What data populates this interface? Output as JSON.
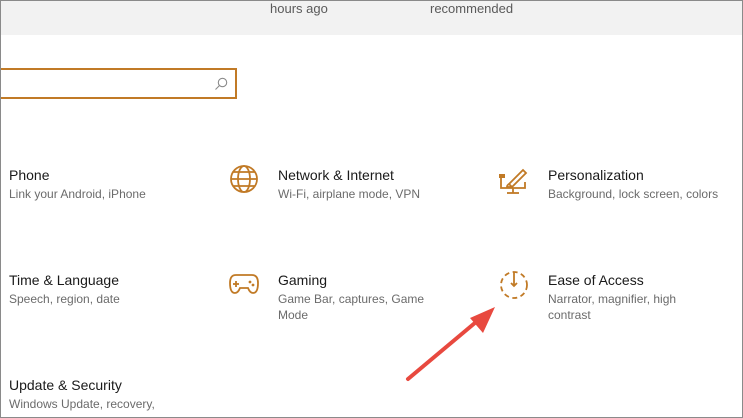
{
  "top": {
    "text_left": "hours ago",
    "text_right": "recommended"
  },
  "search": {
    "value": "",
    "placeholder": ""
  },
  "tiles": [
    {
      "title": "Phone",
      "desc": "Link your Android, iPhone"
    },
    {
      "title": "Network & Internet",
      "desc": "Wi-Fi, airplane mode, VPN"
    },
    {
      "title": "Personalization",
      "desc": "Background, lock screen, colors"
    },
    {
      "title": "Time & Language",
      "desc": "Speech, region, date"
    },
    {
      "title": "Gaming",
      "desc": "Game Bar, captures, Game Mode"
    },
    {
      "title": "Ease of Access",
      "desc": "Narrator, magnifier, high contrast"
    },
    {
      "title": "Update & Security",
      "desc": "Windows Update, recovery,"
    }
  ],
  "icons": {
    "network": "globe-icon",
    "personalization": "paintbrush-icon",
    "gaming": "gamepad-icon",
    "ease": "ease-of-access-icon",
    "search": "search-icon"
  },
  "colors": {
    "accent": "#c17a26",
    "arrow": "#e8493f"
  }
}
